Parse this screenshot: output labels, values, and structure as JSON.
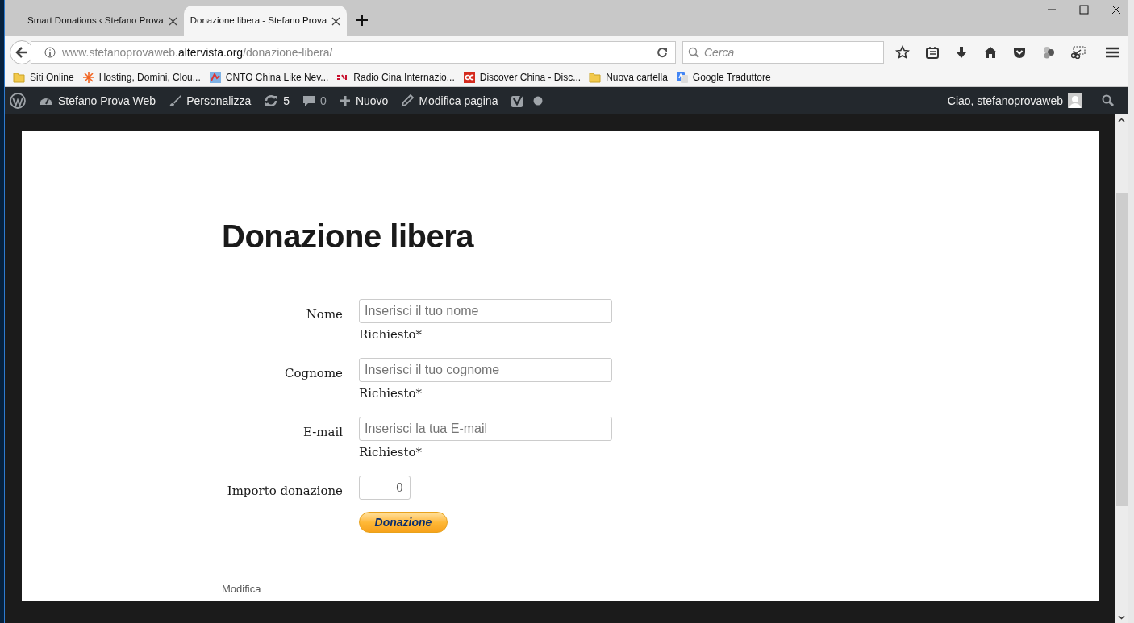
{
  "tabs": [
    {
      "label": "Smart Donations ‹ Stefano Prova",
      "selected": false
    },
    {
      "label": "Donazione libera - Stefano Prova",
      "selected": true
    }
  ],
  "address_bar": {
    "prefix": "www.stefanoprovaweb.",
    "domain": "altervista.org",
    "path": "/donazione-libera/"
  },
  "search": {
    "placeholder": "Cerca"
  },
  "bookmarks": [
    {
      "label": "Siti Online",
      "kind": "folder"
    },
    {
      "label": "Hosting, Domini, Clou...",
      "kind": "star"
    },
    {
      "label": "CNTO China Like Nev...",
      "kind": "flag"
    },
    {
      "label": "Radio Cina Internazio...",
      "kind": "cri"
    },
    {
      "label": "Discover China - Disc...",
      "kind": "dc"
    },
    {
      "label": "Nuova cartella",
      "kind": "folder"
    },
    {
      "label": "Google Traduttore",
      "kind": "translate"
    }
  ],
  "admin_bar": {
    "site": "Stefano Prova Web",
    "customize": "Personalizza",
    "updates": "5",
    "comments": "0",
    "new": "Nuovo",
    "edit": "Modifica pagina",
    "greeting": "Ciao, stefanoprovaweb"
  },
  "page": {
    "title": "Donazione libera",
    "fields": [
      {
        "label": "Nome",
        "placeholder": "Inserisci il tuo nome",
        "note": "Richiesto*"
      },
      {
        "label": "Cognome",
        "placeholder": "Inserisci il tuo cognome",
        "note": "Richiesto*"
      },
      {
        "label": "E-mail",
        "placeholder": "Inserisci la tua E-mail",
        "note": "Richiesto*"
      }
    ],
    "amount": {
      "label": "Importo donazione",
      "value": "0"
    },
    "donate_button": "Donazione",
    "edit_link": "Modifica"
  }
}
